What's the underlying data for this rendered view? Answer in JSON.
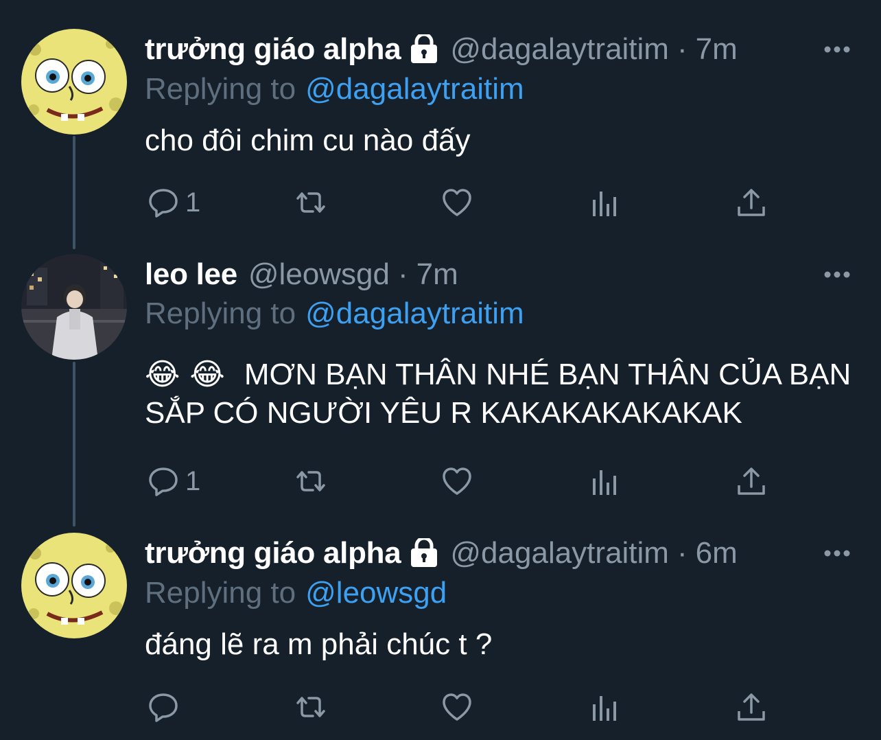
{
  "colors": {
    "background": "#15202b",
    "text": "#ffffff",
    "muted": "#8b98a5",
    "link": "#3ea0f0",
    "thread_line": "#3d5466"
  },
  "tweets": [
    {
      "display_name": "trưởng giáo alpha",
      "protected_icon": "lock-icon",
      "handle": "@dagalaytraitim",
      "separator": "·",
      "time": "7m",
      "replying_label": "Replying to",
      "replying_to": "@dagalaytraitim",
      "text": "cho đôi chim cu nào đấy",
      "reply_count": "1"
    },
    {
      "display_name": "leo lee",
      "handle": "@leowsgd",
      "separator": "·",
      "time": "7m",
      "replying_label": "Replying to",
      "replying_to": "@dagalaytraitim",
      "emoji": "😂 😂",
      "text": "MƠN BẠN THÂN NHÉ BẠN THÂN CỦA BẠN SẮP CÓ NGƯỜI YÊU R KAKAKAKAKAKAK",
      "reply_count": "1"
    },
    {
      "display_name": "trưởng giáo alpha",
      "protected_icon": "lock-icon",
      "handle": "@dagalaytraitim",
      "separator": "·",
      "time": "6m",
      "replying_label": "Replying to",
      "replying_to": "@leowsgd",
      "text": "đáng lẽ ra m phải chúc t ?",
      "reply_count": ""
    }
  ],
  "action_icons": [
    "reply-icon",
    "retweet-icon",
    "like-icon",
    "analytics-icon",
    "share-icon"
  ],
  "more_icon": "more-options-icon"
}
